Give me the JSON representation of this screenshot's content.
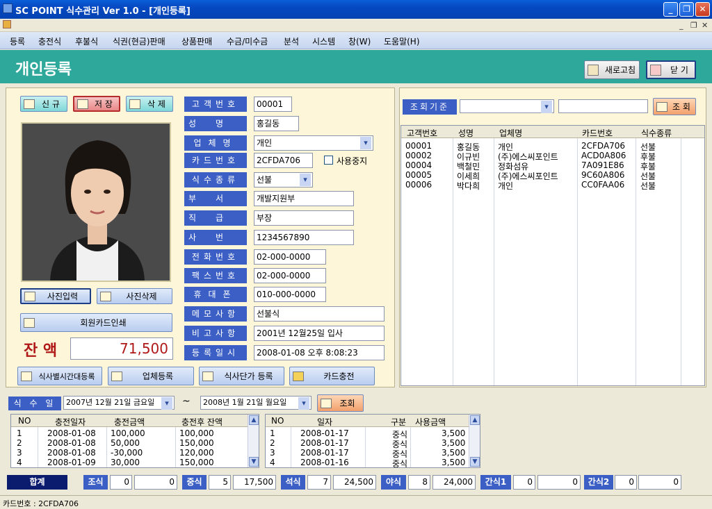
{
  "window": {
    "title": "SC POINT 식수관리 Ver 1.0 - [개인등록]"
  },
  "menu": [
    "등록",
    "충전식",
    "후불식",
    "식권(현금)판매",
    "상품판매",
    "수금/미수금",
    "분석",
    "시스템",
    "창(W)",
    "도움말(H)"
  ],
  "header": {
    "title": "개인등록",
    "refresh_label": "새로고침",
    "close_label": "닫 기"
  },
  "actions": {
    "new_label": "신 규",
    "save_label": "저 장",
    "delete_label": "삭 제"
  },
  "photo_buttons": {
    "input_label": "사진입력",
    "delete_label": "사진삭제",
    "print_card_label": "회원카드인쇄"
  },
  "balance": {
    "label": "잔 액",
    "value": "71,500"
  },
  "bottom_buttons": {
    "meal_time_label": "식사별시간대등록",
    "company_label": "업체등록",
    "meal_price_label": "식사단가 등록",
    "card_charge_label": "카드충전"
  },
  "form": {
    "customer_no": {
      "label": "고객번호",
      "value": "00001"
    },
    "name": {
      "label": "성명",
      "value": "홍길동"
    },
    "company": {
      "label": "업체명",
      "value": "개인"
    },
    "card_no": {
      "label": "카드번호",
      "value": "2CFDA706",
      "suspend_label": "사용중지"
    },
    "meal_type": {
      "label": "식수종류",
      "value": "선불"
    },
    "dept": {
      "label": "부서",
      "value": "개발지원부"
    },
    "rank": {
      "label": "직급",
      "value": "부장"
    },
    "emp_no": {
      "label": "사번",
      "value": "1234567890"
    },
    "phone": {
      "label": "전화번호",
      "value": "02-000-0000"
    },
    "fax": {
      "label": "팩스번호",
      "value": "02-000-0000"
    },
    "mobile": {
      "label": "휴대폰",
      "value": "010-000-0000"
    },
    "memo": {
      "label": "메모사항",
      "value": "선불식"
    },
    "remarks": {
      "label": "비고사항",
      "value": "2001년 12월25일 입사"
    },
    "reg_date": {
      "label": "등록일시",
      "value": "2008-01-08 오후 8:08:23"
    }
  },
  "search": {
    "criteria_label": "조회기준",
    "criteria_value": "",
    "keyword_value": "",
    "button_label": "조 회"
  },
  "customer_list": {
    "columns": [
      "고객번호",
      "성명",
      "업체명",
      "카드번호",
      "식수종류"
    ],
    "rows": [
      [
        "00001",
        "홍길동",
        "개인",
        "2CFDA706",
        "선불"
      ],
      [
        "00002",
        "이규빈",
        "(주)에스씨포인트",
        "ACD0A806",
        "후불"
      ],
      [
        "00004",
        "백철민",
        "정화섬유",
        "7A091E86",
        "후불"
      ],
      [
        "00005",
        "이세희",
        "(주)에스씨포인트",
        "9C60A806",
        "선불"
      ],
      [
        "00006",
        "박다희",
        "개인",
        "CC0FAA06",
        "선불"
      ]
    ]
  },
  "date_filter": {
    "label": "식 수 일",
    "from": "2007년 12월 21일 금요일",
    "sep": "~",
    "to": "2008년  1월 21일 월요일",
    "button_label": "조회"
  },
  "charge_grid": {
    "columns": [
      "NO",
      "충전일자",
      "충전금액",
      "충전후 잔액"
    ],
    "rows": [
      [
        "1",
        "2008-01-08",
        "100,000",
        "100,000"
      ],
      [
        "2",
        "2008-01-08",
        "50,000",
        "150,000"
      ],
      [
        "3",
        "2008-01-08",
        "-30,000",
        "120,000"
      ],
      [
        "4",
        "2008-01-09",
        "30,000",
        "150,000"
      ]
    ]
  },
  "usage_grid": {
    "columns": [
      "NO",
      "일자",
      "구분",
      "사용금액"
    ],
    "rows": [
      [
        "1",
        "2008-01-17",
        "중식",
        "3,500"
      ],
      [
        "2",
        "2008-01-17",
        "중식",
        "3,500"
      ],
      [
        "3",
        "2008-01-17",
        "중식",
        "3,500"
      ],
      [
        "4",
        "2008-01-16",
        "중식",
        "3,500"
      ]
    ]
  },
  "totals": {
    "label": "합계",
    "items": [
      {
        "name": "조식",
        "count": "0",
        "amount": "0"
      },
      {
        "name": "중식",
        "count": "5",
        "amount": "17,500"
      },
      {
        "name": "석식",
        "count": "7",
        "amount": "24,500"
      },
      {
        "name": "야식",
        "count": "8",
        "amount": "24,000"
      },
      {
        "name": "간식1",
        "count": "0",
        "amount": "0"
      },
      {
        "name": "간식2",
        "count": "0",
        "amount": "0"
      }
    ]
  },
  "status": {
    "text": "카드번호 :  2CFDA706"
  },
  "colors": {
    "header_band": "#2ea89a",
    "label_blue": "#3b5fc4",
    "panel_bg": "#fdf6d9",
    "balance_red": "#b01818"
  }
}
